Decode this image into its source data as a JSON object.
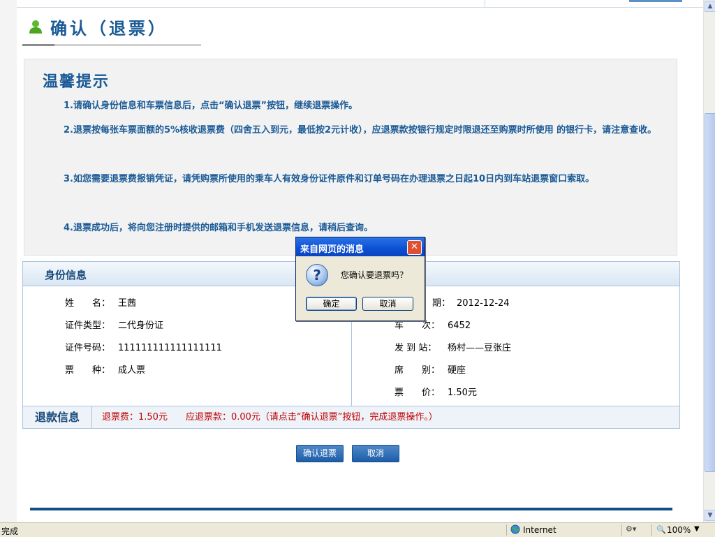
{
  "page": {
    "title": "确认（退票）"
  },
  "tips": {
    "heading": "温馨提示",
    "items": [
      "1.请确认身份信息和车票信息后，点击“确认退票”按钮，继续退票操作。",
      "2.退票按每张车票面额的5%核收退票费（四舍五入到元，最低按2元计收），应退票款按银行规定时限退还至购票时所使用 的银行卡，请注意查收。",
      "3.如您需要退票费报销凭证，请凭购票所使用的乘车人有效身份证件原件和订单号码在办理退票之日起10日内到车站退票窗口索取。",
      "4.退票成功后，将向您注册时提供的邮箱和手机发送退票信息，请稍后查询。"
    ]
  },
  "identity": {
    "heading": "身份信息",
    "name_label": "姓　　名：",
    "name": "王茜",
    "id_type_label": "证件类型：",
    "id_type": "二代身份证",
    "id_number_label": "证件号码：",
    "id_number": "111111111111111111",
    "ticket_type_label": "票　　种：",
    "ticket_type": "成人票"
  },
  "ticket": {
    "date_label_visible": "期：",
    "date": "2012-12-24",
    "train_label": "车　　次：",
    "train": "6452",
    "stations_label": "发 到 站：",
    "stations": "杨村——豆张庄",
    "seat_label": "席　　别：",
    "seat": "硬座",
    "price_label": "票　　价：",
    "price": "1.50元"
  },
  "refund": {
    "heading": "退款信息",
    "text": "退票费：1.50元　　应退票款：0.00元（请点击“确认退票”按钮，完成退票操作。）"
  },
  "buttons": {
    "confirm": "确认退票",
    "cancel": "取消"
  },
  "dialog": {
    "title": "来自网页的消息",
    "message": "您确认要退票吗？",
    "ok": "确定",
    "cancel": "取消",
    "close_glyph": "✕",
    "icon": "question-icon"
  },
  "statusbar": {
    "status": "完成",
    "zone": "Internet",
    "zoom": "100%"
  },
  "colors": {
    "accent": "#1a5a96",
    "refund_text": "#c00000",
    "button_blue": "#1d5ea8"
  }
}
